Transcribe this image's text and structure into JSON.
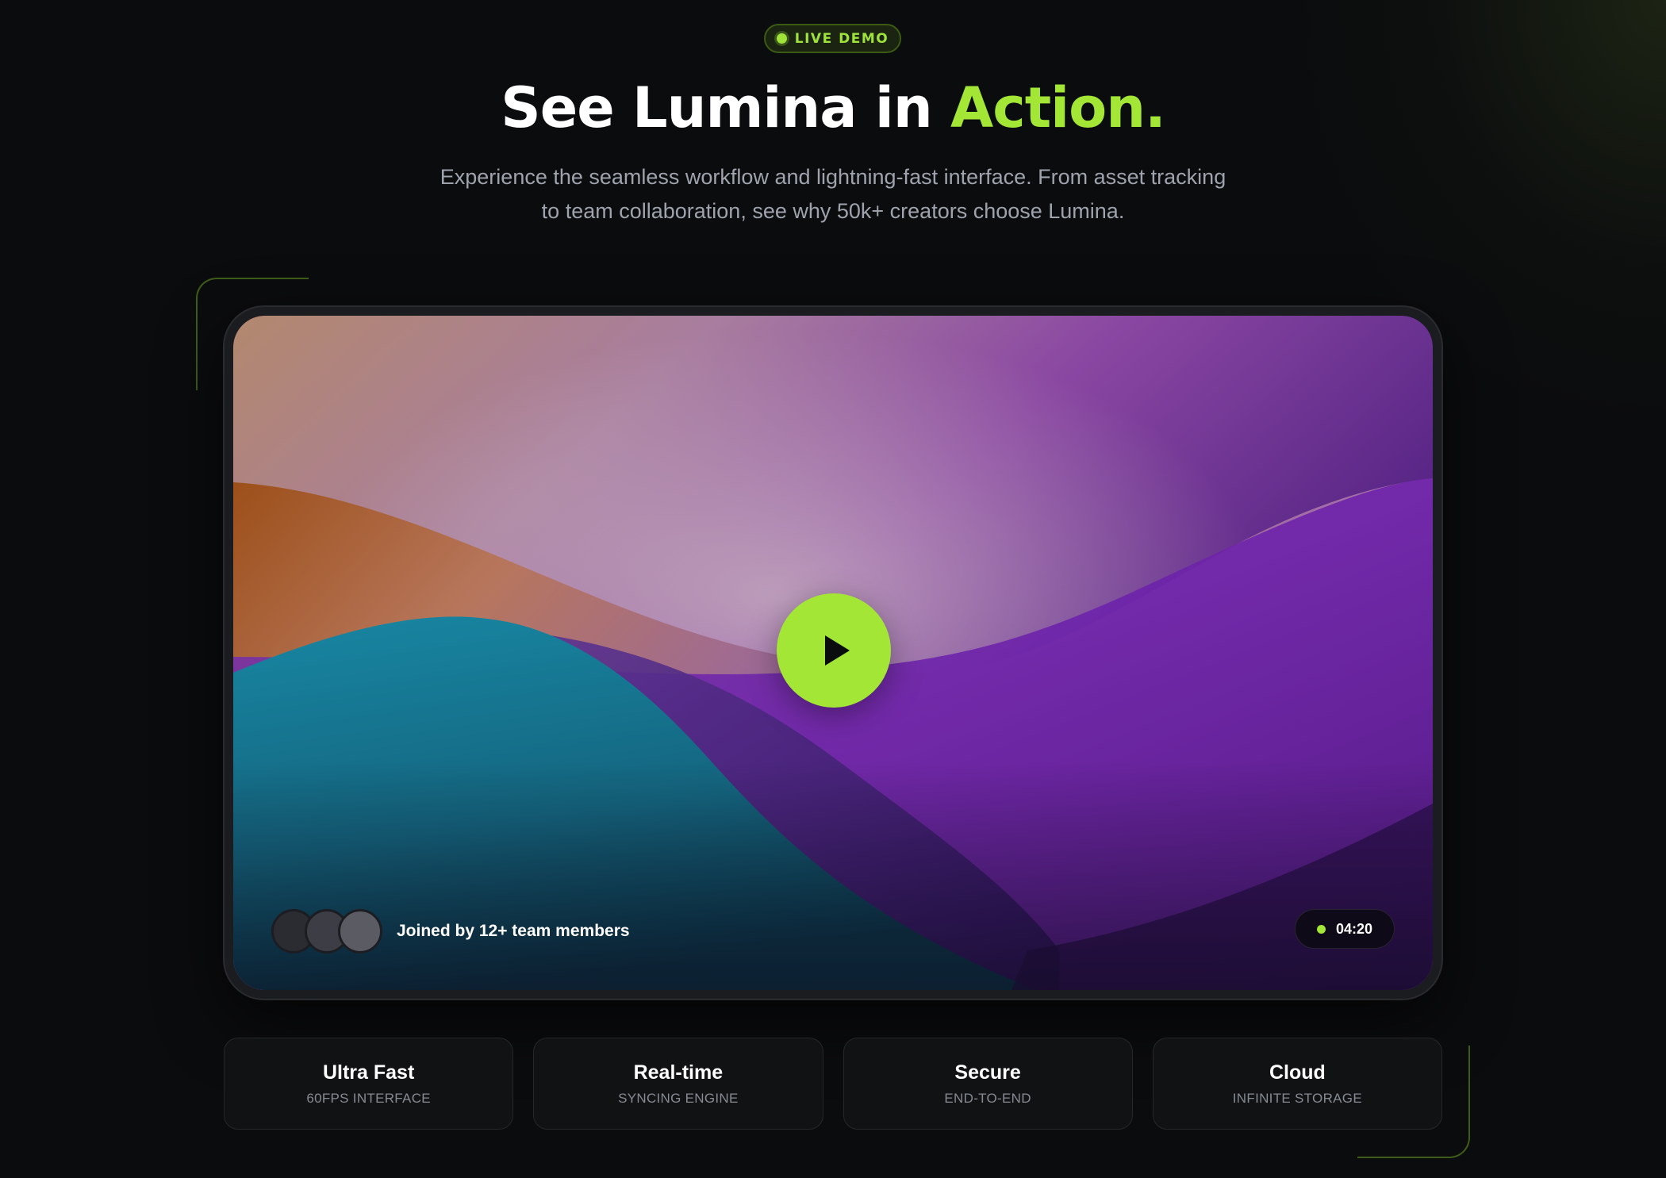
{
  "badge": {
    "label": "LIVE DEMO"
  },
  "headline": {
    "prefix": "See Lumina in ",
    "accent": "Action."
  },
  "subtitle": {
    "line1": "Experience the seamless workflow and lightning-fast interface. From asset tracking",
    "line2": "to team collaboration, see why 50k+ creators choose Lumina."
  },
  "video": {
    "members_label": "Joined by 12+ team members",
    "duration": "04:20"
  },
  "features": [
    {
      "title": "Ultra Fast",
      "subtitle": "60FPS INTERFACE"
    },
    {
      "title": "Real-time",
      "subtitle": "SYNCING ENGINE"
    },
    {
      "title": "Secure",
      "subtitle": "END-TO-END"
    },
    {
      "title": "Cloud",
      "subtitle": "INFINITE STORAGE"
    }
  ],
  "colors": {
    "accent": "#a3e635",
    "background": "#0b0c0e",
    "card": "#111214"
  },
  "icons": [
    "play-icon",
    "live-dot-icon"
  ]
}
